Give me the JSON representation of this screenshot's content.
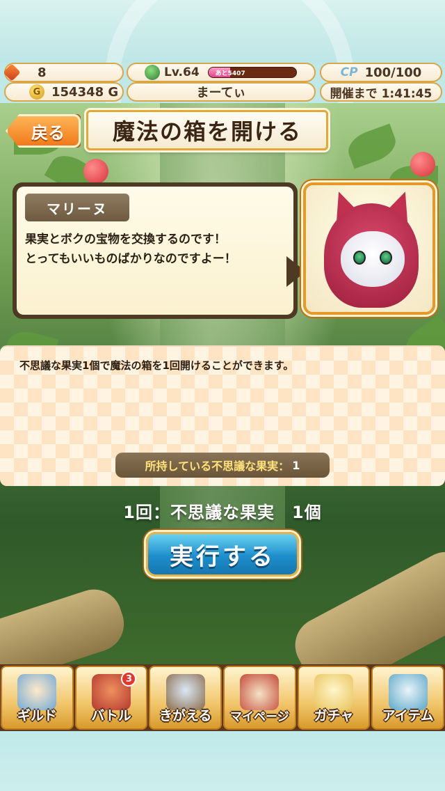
{
  "header": {
    "gems": "8",
    "gold": "154348 G",
    "level": "Lv.64",
    "xp_label": "あと5407",
    "xp_fraction": 0.25,
    "cp_label": "CP",
    "cp_value": "100/100",
    "player_name": "まーてぃ",
    "event_timer": "開催まで 1:41:45"
  },
  "title_bar": {
    "back_label": "戻る",
    "title": "魔法の箱を開ける"
  },
  "dialog": {
    "speaker": "マリーヌ",
    "line1": "果実とボクの宝物を交換するのです！",
    "line2": "とってもいいものばかりなのですよー！"
  },
  "info": {
    "description": "不思議な果実1個で魔法の箱を1回開けることができます。",
    "owned_label": "所持している不思議な果実：",
    "owned_count": "1"
  },
  "cost_line": "1回：不思議な果実　1個",
  "execute_label": "実行する",
  "nav": {
    "items": [
      {
        "label": "ギルド",
        "icon": "guild-icon",
        "color": "#6fa8d6"
      },
      {
        "label": "バトル",
        "icon": "battle-icon",
        "color": "#b2382e",
        "badge": "3"
      },
      {
        "label": "きがえる",
        "icon": "wardrobe-icon",
        "color": "#8a6a4a"
      },
      {
        "label": "マイページ",
        "icon": "mypage-icon",
        "color": "#c44a3a"
      },
      {
        "label": "ガチャ",
        "icon": "gacha-icon",
        "color": "#e8c25a"
      },
      {
        "label": "アイテム",
        "icon": "item-icon",
        "color": "#5aa6c8"
      }
    ]
  },
  "colors": {
    "accent_orange": "#f07a1a",
    "gold_border": "#d9a64a",
    "execute_blue": "#1d8ecc"
  }
}
